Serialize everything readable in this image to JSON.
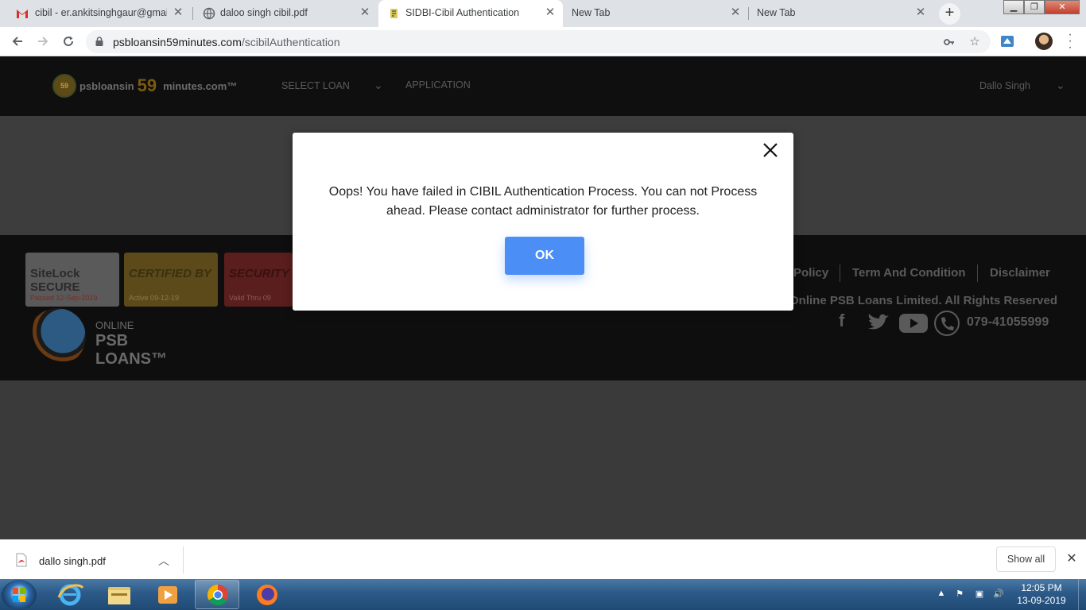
{
  "browser": {
    "tabs": [
      {
        "title": "cibil - er.ankitsinghgaur@gmail.",
        "icon": "gmail-icon"
      },
      {
        "title": "daloo singh cibil.pdf",
        "icon": "globe-icon"
      },
      {
        "title": "SIDBI-Cibil Authentication",
        "icon": "site-favicon",
        "active": true
      },
      {
        "title": "New Tab",
        "icon": "none"
      },
      {
        "title": "New Tab",
        "icon": "none"
      }
    ],
    "tab_close_glyph": "✕",
    "new_tab_glyph": "+",
    "url_host": "psbloansin59minutes.com",
    "url_path": "/scibilAuthentication",
    "window_controls": {
      "minimize": "▁",
      "maximize": "❐",
      "close": "✕"
    }
  },
  "site": {
    "logo_left": "psbloansin",
    "logo_num": "59",
    "logo_right": "minutes.com™",
    "nav": {
      "select_loan": "SELECT LOAN",
      "application": "APPLICATION"
    },
    "user_name": "Dallo Singh",
    "seals": [
      {
        "line1": "SiteLock SECURE",
        "line2": "Passed 12-Sep-2019"
      },
      {
        "line1": "CERTIFIED BY",
        "line2": "Active 09-12-19"
      },
      {
        "line1": "SECURITY SCANNED",
        "line2": "Valid Thru 09"
      }
    ],
    "online_logo": {
      "line1": "ONLINE",
      "line2": "PSB LOANS™"
    },
    "footer_links": [
      "Policy",
      "Term And Condition",
      "Disclaimer"
    ],
    "copyright": "Online PSB Loans Limited. All Rights Reserved",
    "phone": "079-41055999"
  },
  "modal": {
    "message": "Oops! You have failed in CIBIL Authentication Process. You can not Process ahead. Please contact administrator for further process.",
    "ok_label": "OK"
  },
  "downloads": {
    "file_name": "dallo singh.pdf",
    "show_all_label": "Show all"
  },
  "taskbar": {
    "time": "12:05 PM",
    "date": "13-09-2019"
  },
  "colors": {
    "ok_button": "#4a8ef6",
    "header_bg": "#0f0f0f",
    "overlay_bg": "#3a3a3a"
  }
}
